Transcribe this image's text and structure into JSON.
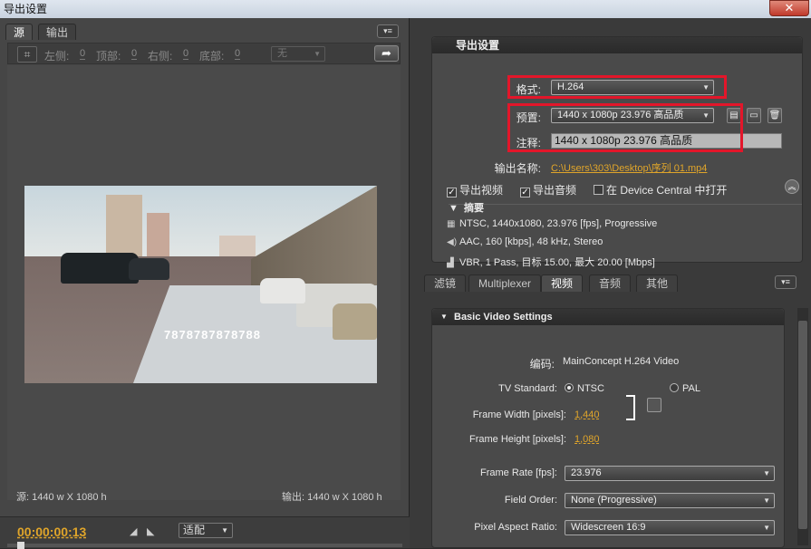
{
  "window": {
    "title": "导出设置",
    "close_label": "✕"
  },
  "left": {
    "tabs": [
      {
        "label": "源"
      },
      {
        "label": "输出"
      }
    ],
    "crop": {
      "left_label": "左侧:",
      "left_value": "0",
      "top_label": "顶部:",
      "top_value": "0",
      "right_label": "右侧:",
      "right_value": "0",
      "bottom_label": "底部:",
      "bottom_value": "0",
      "ratio_value": "无"
    },
    "watermark_text": "7878787878788",
    "source_info": "源: 1440 w X 1080 h",
    "output_info": "输出: 1440 w X 1080 h",
    "timecode": "00:00:00:13",
    "fit_value": "适配"
  },
  "right": {
    "export_settings_title": "导出设置",
    "format_label": "格式:",
    "format_value": "H.264",
    "preset_label": "预置:",
    "preset_value": "1440 x 1080p 23.976 高品质",
    "comment_label": "注释:",
    "comment_value": "1440 x 1080p 23.976 高品质",
    "output_name_label": "输出名称:",
    "output_name_value": "C:\\Users\\303\\Desktop\\序列 01.mp4",
    "export_video_label": "导出视频",
    "export_audio_label": "导出音频",
    "open_dc_label": "在 Device Central 中打开",
    "summary_title": "摘要",
    "summary": [
      "NTSC, 1440x1080, 23.976 [fps], Progressive",
      "AAC, 160 [kbps], 48 kHz, Stereo",
      "VBR, 1 Pass, 目标 15.00, 最大 20.00 [Mbps]"
    ],
    "tabs": [
      {
        "label": "滤镜"
      },
      {
        "label": "Multiplexer"
      },
      {
        "label": "视频"
      },
      {
        "label": "音频"
      },
      {
        "label": "其他"
      }
    ],
    "video": {
      "section_title": "Basic Video Settings",
      "codec_label": "编码:",
      "codec_value": "MainConcept H.264 Video",
      "tv_label": "TV Standard:",
      "ntsc_label": "NTSC",
      "pal_label": "PAL",
      "fw_label": "Frame Width [pixels]:",
      "fw_value": "1,440",
      "fh_label": "Frame Height [pixels]:",
      "fh_value": "1,080",
      "fr_label": "Frame Rate [fps]:",
      "fr_value": "23.976",
      "fo_label": "Field Order:",
      "fo_value": "None (Progressive)",
      "par_label": "Pixel Aspect Ratio:",
      "par_value": "Widescreen 16:9"
    }
  },
  "colors": {
    "accent": "#e0a52a",
    "highlight_box": "#e3162a"
  }
}
